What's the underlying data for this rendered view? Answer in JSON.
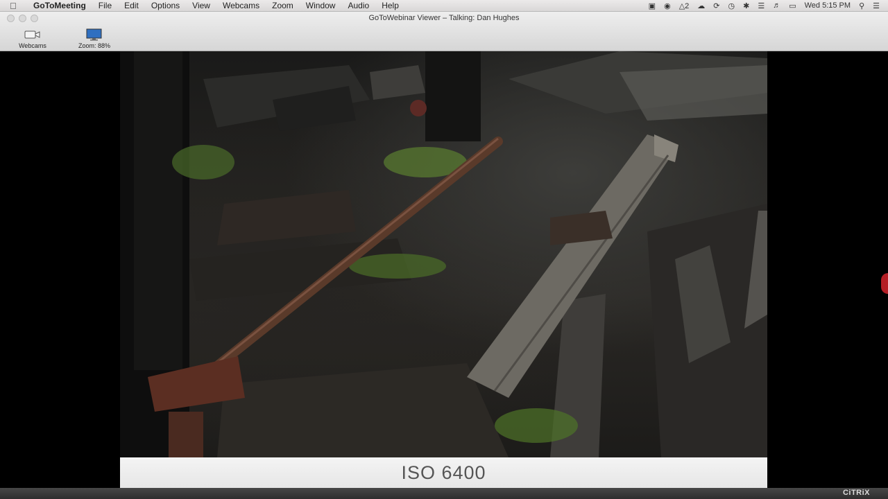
{
  "menubar": {
    "app": "GoToMeeting",
    "items": [
      "File",
      "Edit",
      "Options",
      "View",
      "Webcams",
      "Zoom",
      "Window",
      "Audio",
      "Help"
    ],
    "status_count": "2",
    "clock": "Wed 5:15 PM"
  },
  "window": {
    "title": "GoToWebinar Viewer – Talking: Dan  Hughes"
  },
  "toolbar": {
    "webcams_label": "Webcams",
    "zoom_label": "Zoom: 88%"
  },
  "slide": {
    "caption": "ISO 6400"
  },
  "footer": {
    "brand": "CiTRiX"
  },
  "colors": {
    "accent": "#b51e25",
    "zoom_icon": "#2f6fc0"
  }
}
